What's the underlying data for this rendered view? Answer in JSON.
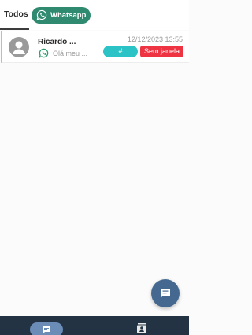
{
  "tabs": {
    "todos_label": "Todos",
    "whatsapp_label": "Whatsapp"
  },
  "ticket": {
    "name": "Ricardo ...",
    "preview": "Olá meu ...",
    "datetime": "12/12/2023 13:55",
    "queue_badge": "#",
    "status_badge": "Sem janela"
  },
  "icons": {
    "whatsapp": "whatsapp-icon",
    "avatar": "user-icon",
    "fab": "message-icon",
    "nav_chat": "chat-icon",
    "nav_contacts": "contacts-icon"
  },
  "colors": {
    "whatsapp_chip": "#2f8a6f",
    "queue_badge": "#2bc3c5",
    "status_badge": "#ee3442",
    "fab": "#44688f",
    "bottom_nav": "#243344",
    "nav_active": "#6a8cb6"
  }
}
